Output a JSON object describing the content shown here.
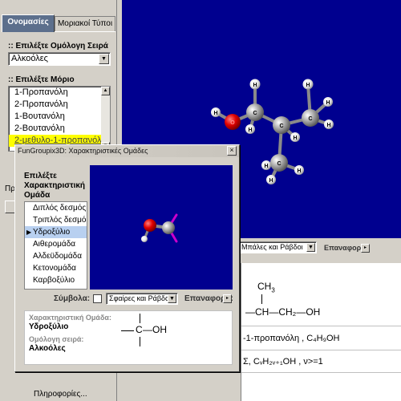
{
  "left_panel": {
    "tabs": [
      {
        "label": "Ονομασίες"
      },
      {
        "label": "Μοριακοί Τύποι"
      }
    ],
    "series_label": ":: Επιλέξτε Ομόλογη Σειρά",
    "series_value": "Αλκοόλες",
    "molecule_label": ":: Επιλέξτε Μόριο",
    "molecules": [
      {
        "label": "1-Προπανόλη"
      },
      {
        "label": "2-Προπανόλη"
      },
      {
        "label": "1-Βουτανόλη"
      },
      {
        "label": "2-Βουτανόλη"
      },
      {
        "label": "2-μεθυλο-1-προπανόλη"
      }
    ],
    "hidden_partial_label": "Πρ",
    "info_link": "Πληροφορίες..."
  },
  "main": {
    "render_label": "Μπάλες και Ράβδοι",
    "reset_label": "Επαναφορά:",
    "formula_ch3": "CH",
    "formula_ch3_sub": "3",
    "formula_chain": "—CH—CH₂—OH",
    "name_line": "-1-προπανόλη , C₄H₉OH",
    "general_line": "Σ, CᵥH₂ᵥ₊₁OH , ν>=1"
  },
  "dialog": {
    "title": "FunGroupix3D: Χαρακτηριστικές Ομάδες",
    "choose_label_line1": "Επιλέξτε",
    "choose_label_line2": "Χαρακτηριστική",
    "choose_label_line3": "Ομάδα",
    "groups": [
      {
        "label": "Διπλός δεσμός"
      },
      {
        "label": "Τριπλός δεσμός"
      },
      {
        "label": "Υδροξύλιο"
      },
      {
        "label": "Αιθερομάδα"
      },
      {
        "label": "Αλδεϋδομάδα"
      },
      {
        "label": "Κετονομάδα"
      },
      {
        "label": "Καρβοξύλιο"
      }
    ],
    "selected_group_index": 2,
    "symbols_label": "Σύμβολα:",
    "render_value": "Σφαίρες και Ράβδοι",
    "reset_label": "Επαναφορά:",
    "char_group_label": "Χαρακτηριστική Ομάδα:",
    "char_group_value": "Υδροξύλιο",
    "homolog_label": "Ομόλογη σειρά:",
    "homolog_value": "Αλκοόλες",
    "structure_c": "C",
    "structure_oh": "—OH"
  },
  "colors": {
    "canvas_bg": "#00008f",
    "oxygen": "#e00000",
    "carbon": "#9a9a9a",
    "hydrogen": "#ffffff",
    "highlight": "#ffff00",
    "tab_active": "#5c6f8c"
  }
}
